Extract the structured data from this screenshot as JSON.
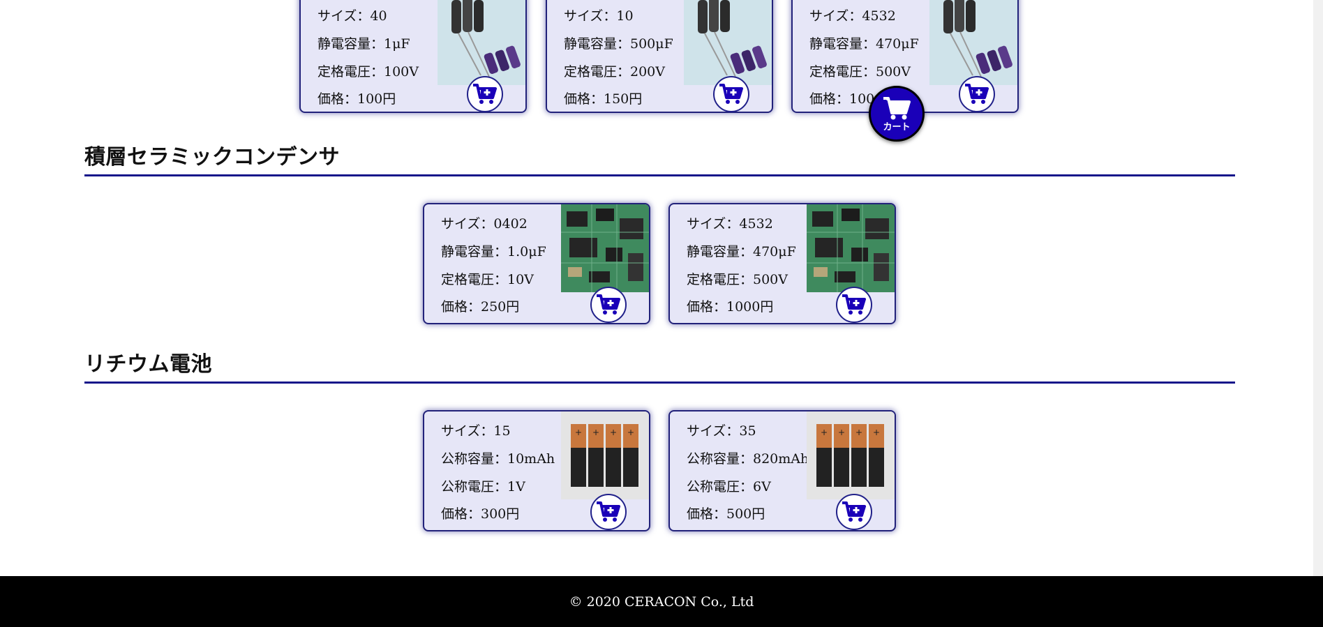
{
  "sections": {
    "ceramic_title": "積層セラミックコンデンサ",
    "lithium_title": "リチウム電池"
  },
  "electrolytic_cards": [
    {
      "size": "サイズ：40",
      "capacitance": "静電容量：1μF",
      "voltage": "定格電圧：100V",
      "price": "価格：100円"
    },
    {
      "size": "サイズ：10",
      "capacitance": "静電容量：500μF",
      "voltage": "定格電圧：200V",
      "price": "価格：150円"
    },
    {
      "size": "サイズ：4532",
      "capacitance": "静電容量：470μF",
      "voltage": "定格電圧：500V",
      "price": "価格：100"
    }
  ],
  "ceramic_cards": [
    {
      "size": "サイズ：0402",
      "capacitance": "静電容量：1.0μF",
      "voltage": "定格電圧：10V",
      "price": "価格：250円"
    },
    {
      "size": "サイズ：4532",
      "capacitance": "静電容量：470μF",
      "voltage": "定格電圧：500V",
      "price": "価格：1000円"
    }
  ],
  "battery_cards": [
    {
      "size": "サイズ：15",
      "capacity": "公称容量：10mAh",
      "voltage": "公称電圧：1V",
      "price": "価格：300円"
    },
    {
      "size": "サイズ：35",
      "capacity": "公称容量：820mAh",
      "voltage": "公称電圧：6V",
      "price": "価格：500円"
    }
  ],
  "floating_cart": {
    "label": "カート"
  },
  "footer": {
    "copyright": "© 2020 CERACON Co., Ltd"
  },
  "colors": {
    "accent": "#1a00b8",
    "card_bg": "#e6e6f7",
    "card_border": "#22227a",
    "rule": "#14148a",
    "footer_bg": "#000000"
  },
  "icons": {
    "cart": "cart-plus-icon",
    "floating": "shopping-cart-icon"
  }
}
